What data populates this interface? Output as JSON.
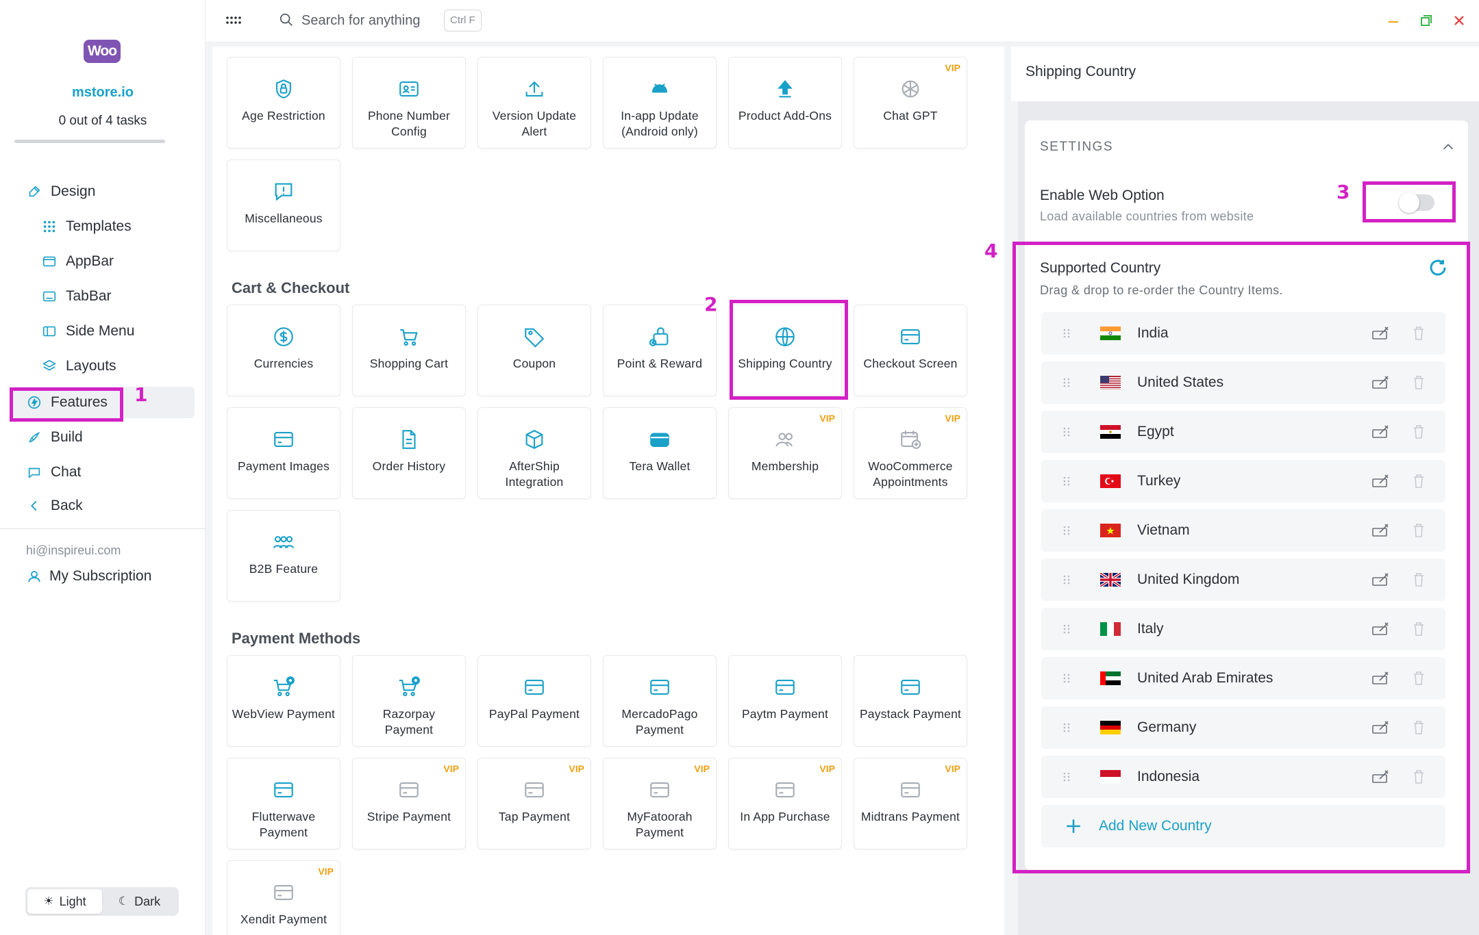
{
  "app": {
    "logo_text": "Woo",
    "store_name": "mstore.io",
    "tasks": "0 out of 4 tasks"
  },
  "nav": {
    "design": "Design",
    "templates": "Templates",
    "appbar": "AppBar",
    "tabbar": "TabBar",
    "side_menu": "Side Menu",
    "layouts": "Layouts",
    "features": "Features",
    "build": "Build",
    "chat": "Chat",
    "back": "Back"
  },
  "account": {
    "email": "hi@inspireui.com",
    "subscription": "My Subscription"
  },
  "theme": {
    "light": "Light",
    "dark": "Dark",
    "selected": "Light"
  },
  "topbar": {
    "search_placeholder": "Search for anything",
    "shortcut": "Ctrl F"
  },
  "features": {
    "general": [
      {
        "label": "Age Restriction",
        "icon": "shield-lock-icon",
        "vip": false
      },
      {
        "label": "Phone Number Config",
        "icon": "contact-card-icon",
        "vip": false
      },
      {
        "label": "Version Update Alert",
        "icon": "upload-icon",
        "vip": false
      },
      {
        "label": "In-app Update (Android only)",
        "icon": "android-icon",
        "vip": false
      },
      {
        "label": "Product Add-Ons",
        "icon": "upload-arrow-icon",
        "vip": false
      },
      {
        "label": "Chat GPT",
        "icon": "openai-icon",
        "vip": true
      },
      {
        "label": "Miscellaneous",
        "icon": "alert-bubble-icon",
        "vip": false
      }
    ],
    "cart_title": "Cart & Checkout",
    "cart": [
      {
        "label": "Currencies",
        "icon": "dollar-icon",
        "vip": false
      },
      {
        "label": "Shopping Cart",
        "icon": "cart-icon",
        "vip": false
      },
      {
        "label": "Coupon",
        "icon": "tag-icon",
        "vip": false
      },
      {
        "label": "Point & Reward",
        "icon": "reward-icon",
        "vip": false
      },
      {
        "label": "Shipping Country",
        "icon": "globe-icon",
        "vip": false
      },
      {
        "label": "Checkout Screen",
        "icon": "card-icon",
        "vip": false
      },
      {
        "label": "Payment Images",
        "icon": "card-icon",
        "vip": false
      },
      {
        "label": "Order History",
        "icon": "document-icon",
        "vip": false
      },
      {
        "label": "AfterShip Integration",
        "icon": "package-icon",
        "vip": false
      },
      {
        "label": "Tera Wallet",
        "icon": "wallet-icon",
        "vip": false
      },
      {
        "label": "Membership",
        "icon": "users-icon",
        "vip": true
      },
      {
        "label": "WooCommerce Appointments",
        "icon": "calendar-icon",
        "vip": true
      },
      {
        "label": "B2B Feature",
        "icon": "group-icon",
        "vip": false
      }
    ],
    "payment_title": "Payment Methods",
    "payment": [
      {
        "label": "WebView Payment",
        "icon": "cart-plus-icon",
        "vip": false
      },
      {
        "label": "Razorpay Payment",
        "icon": "cart-plus-icon",
        "vip": false
      },
      {
        "label": "PayPal Payment",
        "icon": "card-icon",
        "vip": false
      },
      {
        "label": "MercadoPago Payment",
        "icon": "card-icon",
        "vip": false
      },
      {
        "label": "Paytm Payment",
        "icon": "card-icon",
        "vip": false
      },
      {
        "label": "Paystack Payment",
        "icon": "card-icon",
        "vip": false
      },
      {
        "label": "Flutterwave Payment",
        "icon": "card-icon",
        "vip": false
      },
      {
        "label": "Stripe Payment",
        "icon": "card-icon",
        "vip": true
      },
      {
        "label": "Tap Payment",
        "icon": "card-icon",
        "vip": true
      },
      {
        "label": "MyFatoorah Payment",
        "icon": "card-icon",
        "vip": true
      },
      {
        "label": "In App Purchase",
        "icon": "card-icon",
        "vip": true
      },
      {
        "label": "Midtrans Payment",
        "icon": "card-icon",
        "vip": true
      },
      {
        "label": "Xendit Payment",
        "icon": "card-icon",
        "vip": true
      }
    ],
    "vip_label": "VIP"
  },
  "panel": {
    "title": "Shipping Country",
    "settings_label": "SETTINGS",
    "web_option_title": "Enable Web Option",
    "web_option_sub": "Load available countries from website",
    "web_option_enabled": false,
    "supported_title": "Supported Country",
    "supported_sub": "Drag & drop to re-order the Country Items.",
    "add_label": "Add New Country",
    "countries": [
      {
        "name": "India",
        "flag": "IN"
      },
      {
        "name": "United States",
        "flag": "US"
      },
      {
        "name": "Egypt",
        "flag": "EG"
      },
      {
        "name": "Turkey",
        "flag": "TR"
      },
      {
        "name": "Vietnam",
        "flag": "VN"
      },
      {
        "name": "United Kingdom",
        "flag": "GB"
      },
      {
        "name": "Italy",
        "flag": "IT"
      },
      {
        "name": "United Arab Emirates",
        "flag": "AE"
      },
      {
        "name": "Germany",
        "flag": "DE"
      },
      {
        "name": "Indonesia",
        "flag": "ID"
      }
    ]
  },
  "annotations": [
    "1",
    "2",
    "3",
    "4"
  ],
  "colors": {
    "accent": "#1aa1c9",
    "brand": "#7f54b3",
    "highlight": "#d321c4",
    "vip": "#f0a011"
  }
}
